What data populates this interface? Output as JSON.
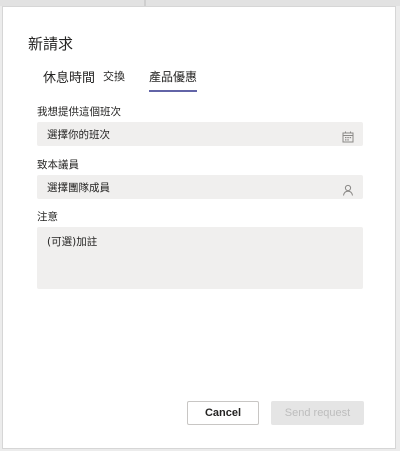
{
  "dialog": {
    "title": "新請求",
    "tabs": [
      {
        "label": "休息時間",
        "active": false
      },
      {
        "label": "交換",
        "active": false
      },
      {
        "label": "產品優惠",
        "active": true
      }
    ]
  },
  "form": {
    "shift_label": "我想提供這個班次",
    "shift_value": "選擇你的班次",
    "shift_icon": "calendar-icon",
    "member_label": "致本議員",
    "member_value": "選擇團隊成員",
    "member_icon": "person-icon",
    "note_label": "注意",
    "note_placeholder": "(可選)加註"
  },
  "actions": {
    "cancel_label": "Cancel",
    "send_label": "Send request"
  },
  "colors": {
    "accent": "#6264a7",
    "field_bg": "#f0efee",
    "disabled_button_bg": "#e5e5e5",
    "disabled_button_text": "#bdbdbd"
  }
}
